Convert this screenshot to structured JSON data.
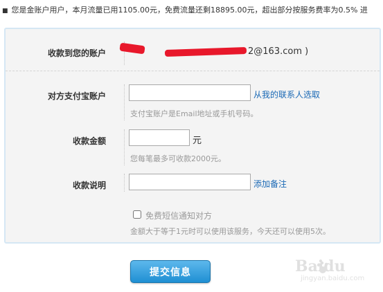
{
  "notice": {
    "text": "您是金账户用户，本月流量已用1105.00元，免费流量还剩18895.00元，超出部分按服务费率为0.5% 进"
  },
  "form": {
    "account": {
      "label": "收款到您的账户",
      "value_suffix": "2@163.com )"
    },
    "payer": {
      "label": "对方支付宝账户",
      "value": "",
      "link": "从我的联系人选取",
      "hint": "支付宝账户是Email地址或手机号码。"
    },
    "amount": {
      "label": "收款金额",
      "value": "",
      "unit": "元",
      "hint": "您每笔最多可收款2000元。"
    },
    "note": {
      "label": "收款说明",
      "value": "",
      "link": "添加备注"
    },
    "sms": {
      "checked": false,
      "label": "免费短信通知对方",
      "hint": "金额大于等于1元时可以使用该服务，今天还可以使用5次。"
    }
  },
  "submit_label": "提交信息",
  "watermark": {
    "logo": "Baidu",
    "sub": "jingyan.baidu.com"
  },
  "colors": {
    "accent": "#1f8fd3",
    "link": "#1968b5",
    "redaction": "#e8182b"
  }
}
